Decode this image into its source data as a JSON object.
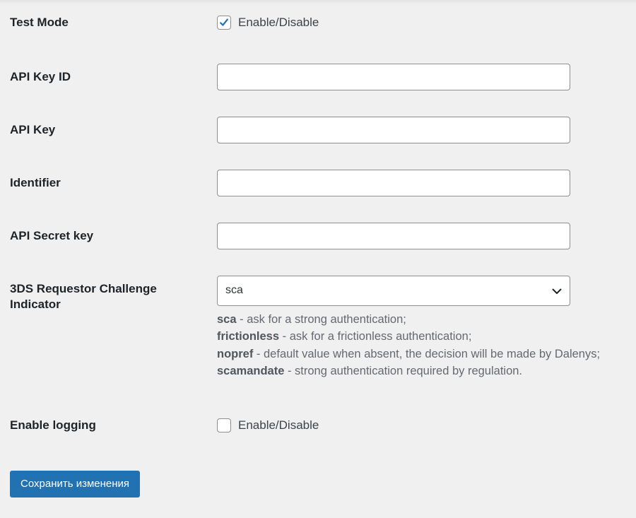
{
  "settings": {
    "test_mode": {
      "label": "Test Mode",
      "checkbox_label": "Enable/Disable",
      "checked": true
    },
    "api_key_id": {
      "label": "API Key ID",
      "value": ""
    },
    "api_key": {
      "label": "API Key",
      "value": ""
    },
    "identifier": {
      "label": "Identifier",
      "value": ""
    },
    "api_secret_key": {
      "label": "API Secret key",
      "value": ""
    },
    "challenge_indicator": {
      "label_line1": "3DS Requestor Challenge",
      "label_line2": "Indicator",
      "selected": "sca",
      "descriptions": [
        {
          "term": "sca",
          "text": " - ask for a strong authentication;"
        },
        {
          "term": "frictionless",
          "text": " - ask for a frictionless authentication;"
        },
        {
          "term": "nopref",
          "text": " - default value when absent, the decision will be made by Dalenys;"
        },
        {
          "term": "scamandate",
          "text": " - strong authentication required by regulation."
        }
      ]
    },
    "enable_logging": {
      "label": "Enable logging",
      "checkbox_label": "Enable/Disable",
      "checked": false
    }
  },
  "footer": {
    "save_label": "Сохранить изменения"
  },
  "colors": {
    "accent": "#2271b1",
    "background": "#f0f0f1",
    "input_border": "#8c8f94",
    "description": "#646970"
  },
  "icons": {
    "check": "checkmark-icon",
    "select": "chevron-down-icon"
  }
}
